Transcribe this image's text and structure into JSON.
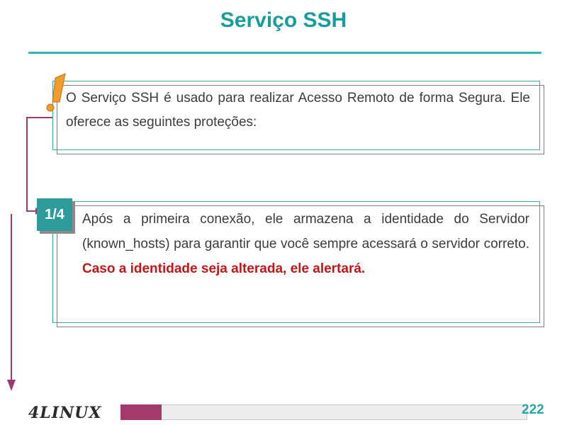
{
  "slide": {
    "title": "Serviço SSH",
    "intro": "O Serviço SSH é usado para realizar Acesso Remoto de forma Segura. Ele oferece as seguintes proteções:",
    "step_badge": "1/4",
    "point_text": "Após a primeira conexão, ele armazena a identidade do Servidor (known_hosts) para garantir que você sempre acessará o servidor correto. ",
    "point_alert": "Caso a identidade seja alterada, ele alertará.",
    "page_number": "222"
  },
  "brand": {
    "logo_text": "4LINUX"
  },
  "colors": {
    "title": "#1a9c9c",
    "accent_teal": "#2f9c9c",
    "alert_red": "#c01818",
    "connector_magenta": "#9b3a6f",
    "exclamation_orange": "#f39c2b"
  },
  "icons": {
    "exclamation": "exclamation-icon",
    "arrow": "arrow-down-icon"
  }
}
